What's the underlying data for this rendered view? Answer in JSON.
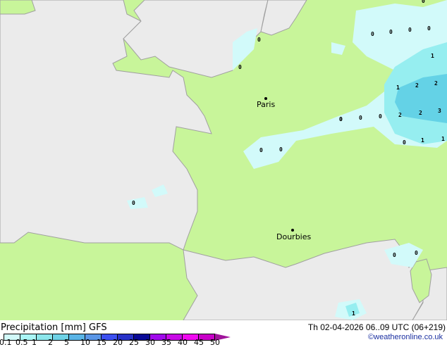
{
  "map": {
    "cities": [
      {
        "name": "Paris"
      },
      {
        "name": "Dourbies"
      }
    ],
    "values": [
      "0",
      "0",
      "0",
      "0",
      "0",
      "1",
      "1",
      "2",
      "2",
      "2",
      "2",
      "3",
      "0",
      "0",
      "1",
      "1",
      "0",
      "0",
      "0",
      "0",
      "0",
      "0",
      "0",
      "0",
      "1",
      "0"
    ]
  },
  "footer": {
    "title": "Precipitation [mm]  GFS",
    "datetime": "Th 02-04-2026 06..09 UTC (06+219)",
    "credit": "©weatheronline.co.uk",
    "legend_ticks": [
      "0.1",
      "0.5",
      "1",
      "2",
      "5",
      "10",
      "15",
      "20",
      "25",
      "30",
      "35",
      "40",
      "45",
      "50"
    ],
    "legend_colors": [
      "#d2fafa",
      "#aaf5f5",
      "#8ce6eb",
      "#6ed2e6",
      "#5ab4e6",
      "#5a96e6",
      "#3c50f0",
      "#2832c8",
      "#0a0a96",
      "#a00aeb",
      "#c80ae6",
      "#f00af0",
      "#c800c8"
    ]
  },
  "colors": {
    "land": "#c8f59a",
    "sea": "#ebebeb",
    "precip_light": "#d2fafa",
    "precip_mid": "#96eef0",
    "precip_heavy": "#64d2e6"
  }
}
